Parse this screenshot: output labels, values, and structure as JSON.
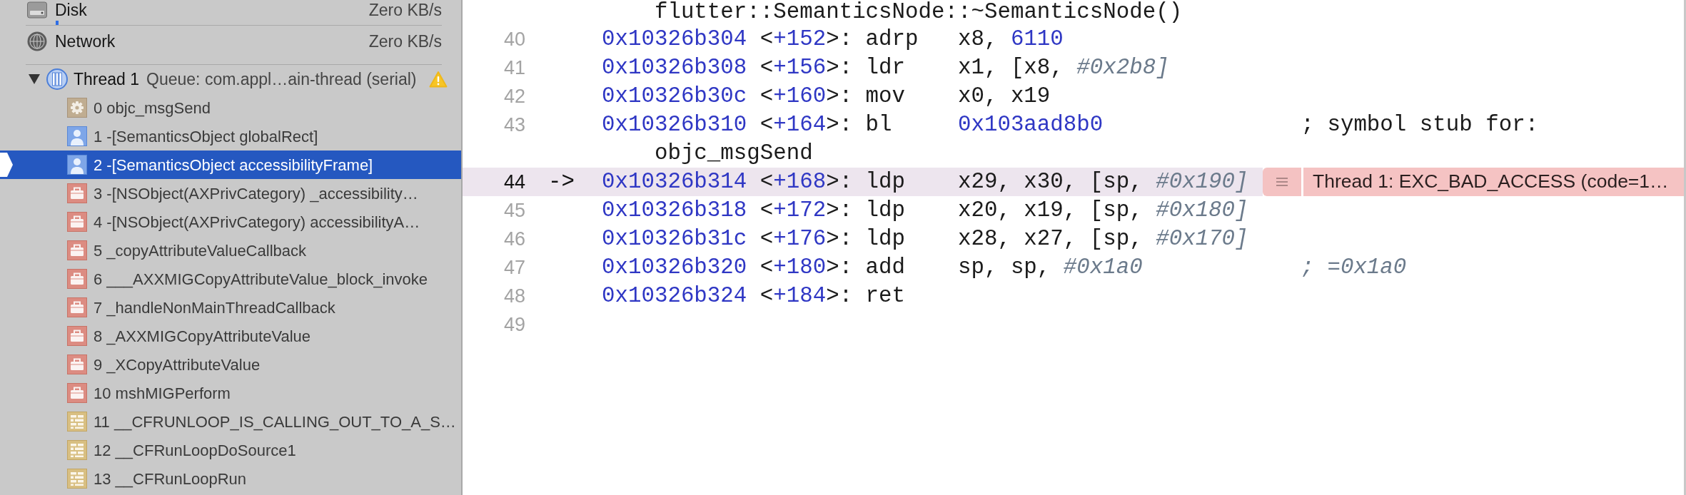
{
  "gauges": [
    {
      "kind": "disk",
      "label": "Disk",
      "value": "Zero KB/s"
    },
    {
      "kind": "network",
      "label": "Network",
      "value": "Zero KB/s"
    }
  ],
  "thread": {
    "name": "Thread 1",
    "queue": "Queue: com.appl…ain-thread (serial)",
    "expanded": true,
    "warning": true,
    "frames": [
      {
        "kind": "gear",
        "label": "0 objc_msgSend",
        "selected": false
      },
      {
        "kind": "person",
        "label": "1 -[SemanticsObject globalRect]",
        "selected": false
      },
      {
        "kind": "person",
        "label": "2 -[SemanticsObject accessibilityFrame]",
        "selected": true
      },
      {
        "kind": "briefcase",
        "label": "3 -[NSObject(AXPrivCategory) _accessibility…",
        "selected": false
      },
      {
        "kind": "briefcase",
        "label": "4 -[NSObject(AXPrivCategory) accessibilityA…",
        "selected": false
      },
      {
        "kind": "briefcase",
        "label": "5 _copyAttributeValueCallback",
        "selected": false
      },
      {
        "kind": "briefcase",
        "label": "6 ___AXXMIGCopyAttributeValue_block_invoke",
        "selected": false
      },
      {
        "kind": "briefcase",
        "label": "7 _handleNonMainThreadCallback",
        "selected": false
      },
      {
        "kind": "briefcase",
        "label": "8 _AXXMIGCopyAttributeValue",
        "selected": false
      },
      {
        "kind": "briefcase",
        "label": "9 _XCopyAttributeValue",
        "selected": false
      },
      {
        "kind": "briefcase",
        "label": "10 mshMIGPerform",
        "selected": false
      },
      {
        "kind": "brick",
        "label": "11 __CFRUNLOOP_IS_CALLING_OUT_TO_A_S…",
        "selected": false
      },
      {
        "kind": "brick",
        "label": "12 __CFRunLoopDoSource1",
        "selected": false
      },
      {
        "kind": "brick",
        "label": "13 __CFRunLoopRun",
        "selected": false
      }
    ]
  },
  "editor": {
    "lines": [
      {
        "kind": "continuation",
        "text": "flutter::SemanticsNode::~SemanticsNode()"
      },
      {
        "kind": "instruction",
        "number": "40",
        "current": false,
        "address": "0x10326b304",
        "offset": [
          {
            "text": "<",
            "kind": "plain"
          },
          {
            "text": "+152",
            "kind": "number"
          },
          {
            "text": ">:",
            "kind": "plain"
          }
        ],
        "mnemonic": "adrp",
        "operands": [
          {
            "text": "x8, ",
            "kind": "plain"
          },
          {
            "text": "6110",
            "kind": "number"
          }
        ]
      },
      {
        "kind": "instruction",
        "number": "41",
        "current": false,
        "address": "0x10326b308",
        "offset": [
          {
            "text": "<",
            "kind": "plain"
          },
          {
            "text": "+156",
            "kind": "number"
          },
          {
            "text": ">:",
            "kind": "plain"
          }
        ],
        "mnemonic": "ldr",
        "operands": [
          {
            "text": "x1, [x8, ",
            "kind": "plain"
          },
          {
            "text": "#0x2b8]",
            "kind": "immediate"
          }
        ]
      },
      {
        "kind": "instruction",
        "number": "42",
        "current": false,
        "address": "0x10326b30c",
        "offset": [
          {
            "text": "<",
            "kind": "plain"
          },
          {
            "text": "+160",
            "kind": "number"
          },
          {
            "text": ">:",
            "kind": "plain"
          }
        ],
        "mnemonic": "mov",
        "operands": [
          {
            "text": "x0, x19",
            "kind": "plain"
          }
        ]
      },
      {
        "kind": "instruction",
        "number": "43",
        "current": false,
        "address": "0x10326b310",
        "offset": [
          {
            "text": "<",
            "kind": "plain"
          },
          {
            "text": "+164",
            "kind": "number"
          },
          {
            "text": ">:",
            "kind": "plain"
          }
        ],
        "mnemonic": "bl",
        "operands": [
          {
            "text": "0x103aad8b0",
            "kind": "number"
          }
        ],
        "comment": [
          {
            "text": "; symbol stub for:",
            "kind": "plain"
          }
        ]
      },
      {
        "kind": "continuation",
        "text": "objc_msgSend"
      },
      {
        "kind": "instruction",
        "number": "44",
        "current": true,
        "marker": "->",
        "address": "0x10326b314",
        "offset": [
          {
            "text": "<",
            "kind": "plain"
          },
          {
            "text": "+168",
            "kind": "number"
          },
          {
            "text": ">:",
            "kind": "plain"
          }
        ],
        "mnemonic": "ldp",
        "operands": [
          {
            "text": "x29, x30, [sp, ",
            "kind": "plain"
          },
          {
            "text": "#0x190]",
            "kind": "immediate"
          }
        ],
        "issue": {
          "message": "Thread 1: EXC_BAD_ACCESS (code=1…"
        }
      },
      {
        "kind": "instruction",
        "number": "45",
        "current": false,
        "address": "0x10326b318",
        "offset": [
          {
            "text": "<",
            "kind": "plain"
          },
          {
            "text": "+172",
            "kind": "number"
          },
          {
            "text": ">:",
            "kind": "plain"
          }
        ],
        "mnemonic": "ldp",
        "operands": [
          {
            "text": "x20, x19, [sp, ",
            "kind": "plain"
          },
          {
            "text": "#0x180]",
            "kind": "immediate"
          }
        ]
      },
      {
        "kind": "instruction",
        "number": "46",
        "current": false,
        "address": "0x10326b31c",
        "offset": [
          {
            "text": "<",
            "kind": "plain"
          },
          {
            "text": "+176",
            "kind": "number"
          },
          {
            "text": ">:",
            "kind": "plain"
          }
        ],
        "mnemonic": "ldp",
        "operands": [
          {
            "text": "x28, x27, [sp, ",
            "kind": "plain"
          },
          {
            "text": "#0x170]",
            "kind": "immediate"
          }
        ]
      },
      {
        "kind": "instruction",
        "number": "47",
        "current": false,
        "address": "0x10326b320",
        "offset": [
          {
            "text": "<",
            "kind": "plain"
          },
          {
            "text": "+180",
            "kind": "number"
          },
          {
            "text": ">:",
            "kind": "plain"
          }
        ],
        "mnemonic": "add",
        "operands": [
          {
            "text": "sp, sp, ",
            "kind": "plain"
          },
          {
            "text": "#0x1a0",
            "kind": "immediate"
          }
        ],
        "comment": [
          {
            "text": "; =0x1a0",
            "kind": "immediate"
          }
        ]
      },
      {
        "kind": "instruction",
        "number": "48",
        "current": false,
        "address": "0x10326b324",
        "offset": [
          {
            "text": "<",
            "kind": "plain"
          },
          {
            "text": "+184",
            "kind": "number"
          },
          {
            "text": ">:",
            "kind": "plain"
          }
        ],
        "mnemonic": "ret"
      },
      {
        "kind": "blank",
        "number": "49",
        "current": false
      }
    ]
  }
}
